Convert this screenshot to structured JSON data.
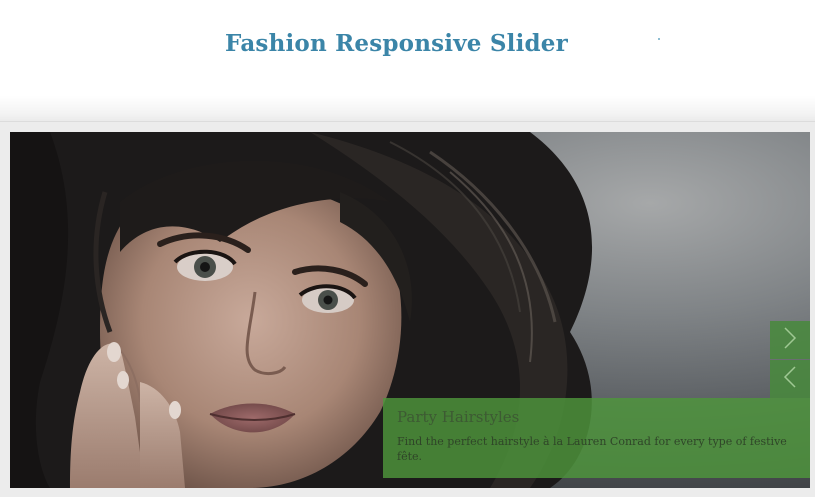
{
  "header": {
    "title": "Fashion Responsive Slider"
  },
  "slider": {
    "slide": {
      "image": "portrait-woman-dark-wavy-hair",
      "caption_title": "Party Hairstyles",
      "caption_text": "Find the perfect hairstyle à la Lauren Conrad for every type of festive fête."
    },
    "controls": {
      "next_icon": "chevron-right-icon",
      "prev_icon": "chevron-left-icon"
    }
  },
  "colors": {
    "title": "#3b85a8",
    "caption_bg": "#4e963c",
    "arrow_bg": "#488a3c"
  }
}
